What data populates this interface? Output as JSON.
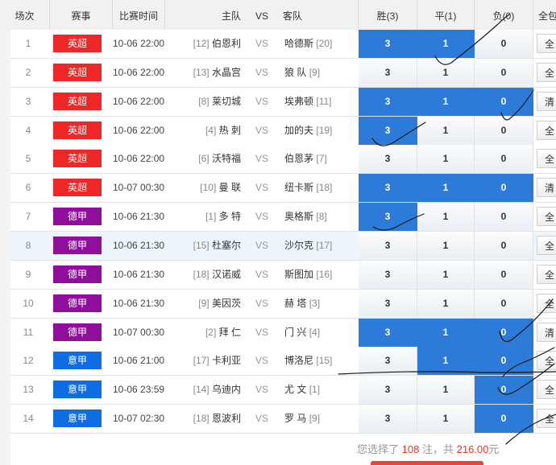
{
  "header": {
    "idx": "场次",
    "league": "赛事",
    "time": "比赛时间",
    "home": "主队",
    "vs": "VS",
    "away": "客队",
    "win": "胜(3)",
    "draw": "平(1)",
    "lose": "负(0)",
    "all": "全包"
  },
  "colors": {
    "英超": "#f02727",
    "德甲": "#8f0e9c",
    "意甲": "#0e6de2",
    "selected": "#2c7bd8",
    "highlight_row": "#edf6fd"
  },
  "matches": [
    {
      "idx": "1",
      "league": "英超",
      "time": "10-06 22:00",
      "home_rank": "[12]",
      "home": "伯恩利",
      "vs": "VS",
      "away": "哈德斯",
      "away_rank": "[20]",
      "win": "3",
      "draw": "1",
      "lose": "0",
      "sel": [
        true,
        true,
        false
      ],
      "btn": "全"
    },
    {
      "idx": "2",
      "league": "英超",
      "time": "10-06 22:00",
      "home_rank": "[13]",
      "home": "水晶宫",
      "vs": "VS",
      "away": "狼 队",
      "away_rank": "[9]",
      "win": "3",
      "draw": "1",
      "lose": "0",
      "sel": [
        false,
        false,
        false
      ],
      "btn": "全"
    },
    {
      "idx": "3",
      "league": "英超",
      "time": "10-06 22:00",
      "home_rank": "[8]",
      "home": "莱切城",
      "vs": "VS",
      "away": "埃弗顿",
      "away_rank": "[11]",
      "win": "3",
      "draw": "1",
      "lose": "0",
      "sel": [
        true,
        true,
        true
      ],
      "btn": "清"
    },
    {
      "idx": "4",
      "league": "英超",
      "time": "10-06 22:00",
      "home_rank": "[4]",
      "home": "热 刺",
      "vs": "VS",
      "away": "加的夫",
      "away_rank": "[19]",
      "win": "3",
      "draw": "1",
      "lose": "0",
      "sel": [
        true,
        false,
        false
      ],
      "btn": "全"
    },
    {
      "idx": "5",
      "league": "英超",
      "time": "10-06 22:00",
      "home_rank": "[6]",
      "home": "沃特福",
      "vs": "VS",
      "away": "伯恩茅",
      "away_rank": "[7]",
      "win": "3",
      "draw": "1",
      "lose": "0",
      "sel": [
        false,
        false,
        false
      ],
      "btn": "全"
    },
    {
      "idx": "6",
      "league": "英超",
      "time": "10-07 00:30",
      "home_rank": "[10]",
      "home": "曼 联",
      "vs": "VS",
      "away": "纽卡斯",
      "away_rank": "[18]",
      "win": "3",
      "draw": "1",
      "lose": "0",
      "sel": [
        true,
        true,
        true
      ],
      "btn": "清"
    },
    {
      "idx": "7",
      "league": "德甲",
      "time": "10-06 21:30",
      "home_rank": "[1]",
      "home": "多 特",
      "vs": "VS",
      "away": "奥格斯",
      "away_rank": "[8]",
      "win": "3",
      "draw": "1",
      "lose": "0",
      "sel": [
        true,
        false,
        false
      ],
      "btn": "全"
    },
    {
      "idx": "8",
      "league": "德甲",
      "time": "10-06 21:30",
      "home_rank": "[15]",
      "home": "杜塞尔",
      "vs": "VS",
      "away": "沙尔克",
      "away_rank": "[17]",
      "win": "3",
      "draw": "1",
      "lose": "0",
      "sel": [
        false,
        false,
        false
      ],
      "btn": "全",
      "hl": true
    },
    {
      "idx": "9",
      "league": "德甲",
      "time": "10-06 21:30",
      "home_rank": "[18]",
      "home": "汉诺威",
      "vs": "VS",
      "away": "斯图加",
      "away_rank": "[16]",
      "win": "3",
      "draw": "1",
      "lose": "0",
      "sel": [
        false,
        false,
        false
      ],
      "btn": "全"
    },
    {
      "idx": "10",
      "league": "德甲",
      "time": "10-06 21:30",
      "home_rank": "[9]",
      "home": "美因茨",
      "vs": "VS",
      "away": "赫 塔",
      "away_rank": "[3]",
      "win": "3",
      "draw": "1",
      "lose": "0",
      "sel": [
        false,
        false,
        false
      ],
      "btn": "全"
    },
    {
      "idx": "11",
      "league": "德甲",
      "time": "10-07 00:30",
      "home_rank": "[2]",
      "home": "拜 仁",
      "vs": "VS",
      "away": "门 兴",
      "away_rank": "[4]",
      "win": "3",
      "draw": "1",
      "lose": "0",
      "sel": [
        true,
        true,
        true
      ],
      "btn": "清"
    },
    {
      "idx": "12",
      "league": "意甲",
      "time": "10-06 21:00",
      "home_rank": "[17]",
      "home": "卡利亚",
      "vs": "VS",
      "away": "博洛尼",
      "away_rank": "[15]",
      "win": "3",
      "draw": "1",
      "lose": "0",
      "sel": [
        false,
        true,
        true
      ],
      "btn": "全"
    },
    {
      "idx": "13",
      "league": "意甲",
      "time": "10-06 23:59",
      "home_rank": "[14]",
      "home": "乌迪内",
      "vs": "VS",
      "away": "尤 文",
      "away_rank": "[1]",
      "win": "3",
      "draw": "1",
      "lose": "0",
      "sel": [
        false,
        false,
        true
      ],
      "btn": "全"
    },
    {
      "idx": "14",
      "league": "意甲",
      "time": "10-07 02:30",
      "home_rank": "[18]",
      "home": "恩波利",
      "vs": "VS",
      "away": "罗 马",
      "away_rank": "[9]",
      "win": "3",
      "draw": "1",
      "lose": "0",
      "sel": [
        false,
        false,
        true
      ],
      "btn": "全"
    }
  ],
  "summary": {
    "prefix": "您选择了",
    "count": "108",
    "mid": "注，共",
    "amount": "216.00",
    "suffix": "元"
  }
}
